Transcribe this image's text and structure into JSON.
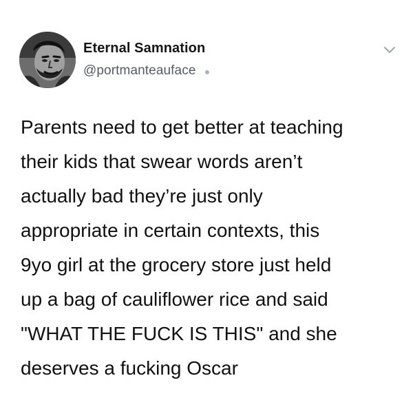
{
  "tweet": {
    "author": {
      "display_name": "Eternal Samnation",
      "handle": "@portmanteauface"
    },
    "icons": {
      "avatar": "profile-photo",
      "menu": "chevron-down-icon",
      "status": "dot-icon"
    },
    "text": "Parents need to get better at teaching\ntheir kids that swear words aren’t\nactually bad they’re just only\nappropriate in certain contexts, this\n9yo girl at the grocery store just held\nup a bag of cauliflower rice and said\n\"WHAT THE FUCK IS THIS\" and she\ndeserves a fucking Oscar"
  }
}
